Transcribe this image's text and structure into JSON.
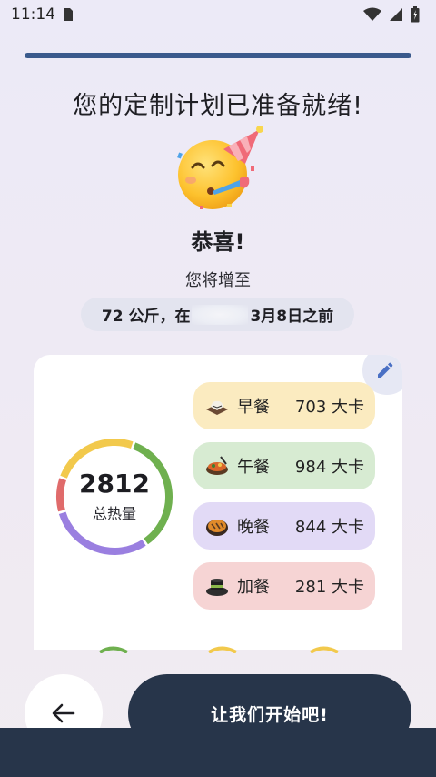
{
  "status_bar": {
    "time": "11:14"
  },
  "progress": {
    "fraction": 1.0,
    "color": "#3a5a8c"
  },
  "header": {
    "headline": "您的定制计划已准备就绪!",
    "congrats": "恭喜!",
    "subline": "您将增至",
    "goal_prefix": "72 公斤，在",
    "goal_suffix": "3月8日之前"
  },
  "summary": {
    "total_calories": "2812",
    "total_label": "总热量",
    "ring_segments": [
      {
        "name": "早餐",
        "value": 703,
        "color": "#F2C94C"
      },
      {
        "name": "午餐",
        "value": 984,
        "color": "#6FB04F"
      },
      {
        "name": "晚餐",
        "value": 844,
        "color": "#9A7FE0"
      },
      {
        "name": "加餐",
        "value": 281,
        "color": "#E06B6B"
      }
    ]
  },
  "meals": [
    {
      "name": "早餐",
      "kcal": "703 大卡",
      "bg": "#FBEBC0",
      "icon": "breakfast-icon"
    },
    {
      "name": "午餐",
      "kcal": "984 大卡",
      "bg": "#D7EBD2",
      "icon": "lunch-icon"
    },
    {
      "name": "晚餐",
      "kcal": "844 大卡",
      "bg": "#E2DAF6",
      "icon": "dinner-icon"
    },
    {
      "name": "加餐",
      "kcal": "281 大卡",
      "bg": "#F6D4D4",
      "icon": "snack-icon"
    }
  ],
  "actions": {
    "start_label": "让我们开始吧!"
  }
}
